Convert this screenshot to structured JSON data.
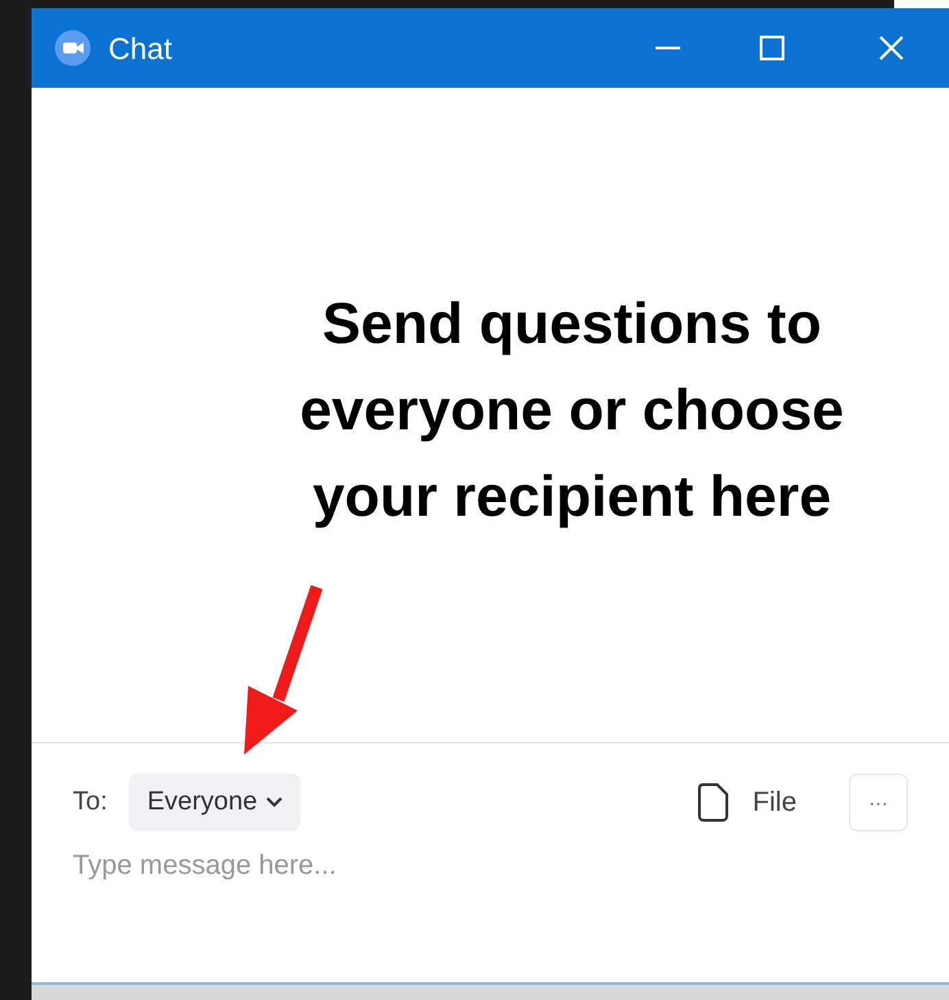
{
  "window": {
    "title": "Chat"
  },
  "annotation": {
    "text": "Send questions to everyone or choose your recipient here"
  },
  "composer": {
    "to_label": "To:",
    "recipient": "Everyone",
    "file_label": "File",
    "more_label": "···",
    "placeholder": "Type message here..."
  }
}
